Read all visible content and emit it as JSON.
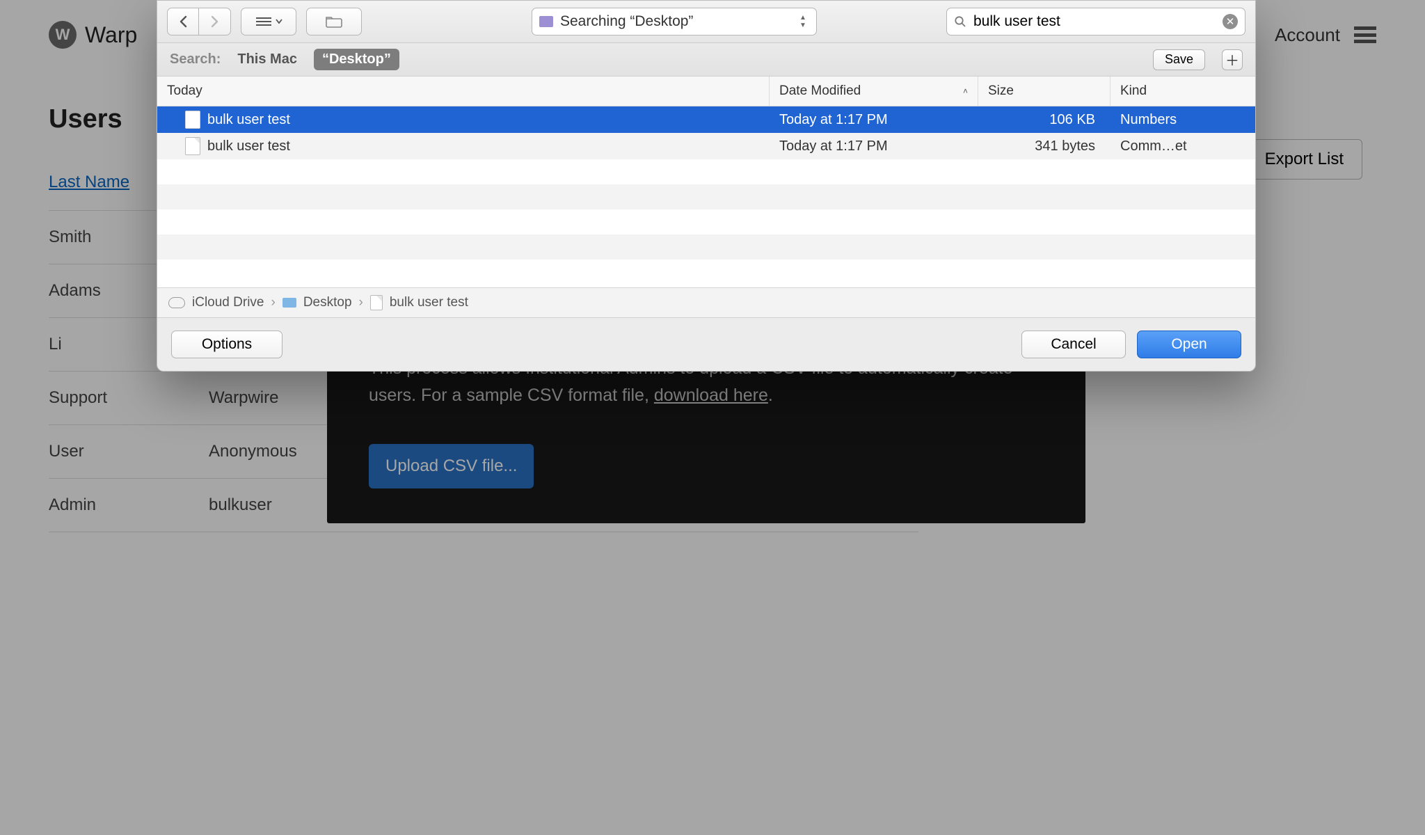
{
  "header": {
    "brand_initial": "W",
    "brand": "Warp",
    "account_label": "Account"
  },
  "page": {
    "title": "Users",
    "export_button": "Export List",
    "column_header": "Last Name"
  },
  "rows": [
    {
      "last": "Smith",
      "first": ""
    },
    {
      "last": "Adams",
      "first": ""
    },
    {
      "last": "Li",
      "first": ""
    },
    {
      "last": "Support",
      "first": "Warpwire"
    },
    {
      "last": "User",
      "first": "Anonymous"
    },
    {
      "last": "Admin",
      "first": "bulkuser"
    }
  ],
  "bulk_modal": {
    "text_a": "This process allows Institutional Admins to upload a CSV file to automatically create users. For a sample CSV format file, ",
    "link": "download here",
    "text_b": ".",
    "button": "Upload CSV file..."
  },
  "dialog": {
    "location": "Searching “Desktop”",
    "search_value": "bulk user test",
    "scope_label": "Search:",
    "scope_this_mac": "This Mac",
    "scope_desktop": "“Desktop”",
    "save": "Save",
    "columns": {
      "name": "Today",
      "date": "Date Modified",
      "size": "Size",
      "kind": "Kind"
    },
    "files": [
      {
        "name": "bulk user test",
        "date": "Today at 1:17 PM",
        "size": "106 KB",
        "kind": "Numbers",
        "selected": true
      },
      {
        "name": "bulk user test",
        "date": "Today at 1:17 PM",
        "size": "341 bytes",
        "kind": "Comm…et",
        "selected": false
      }
    ],
    "path": {
      "icloud": "iCloud Drive",
      "desktop": "Desktop",
      "file": "bulk user test"
    },
    "options": "Options",
    "cancel": "Cancel",
    "open": "Open"
  }
}
